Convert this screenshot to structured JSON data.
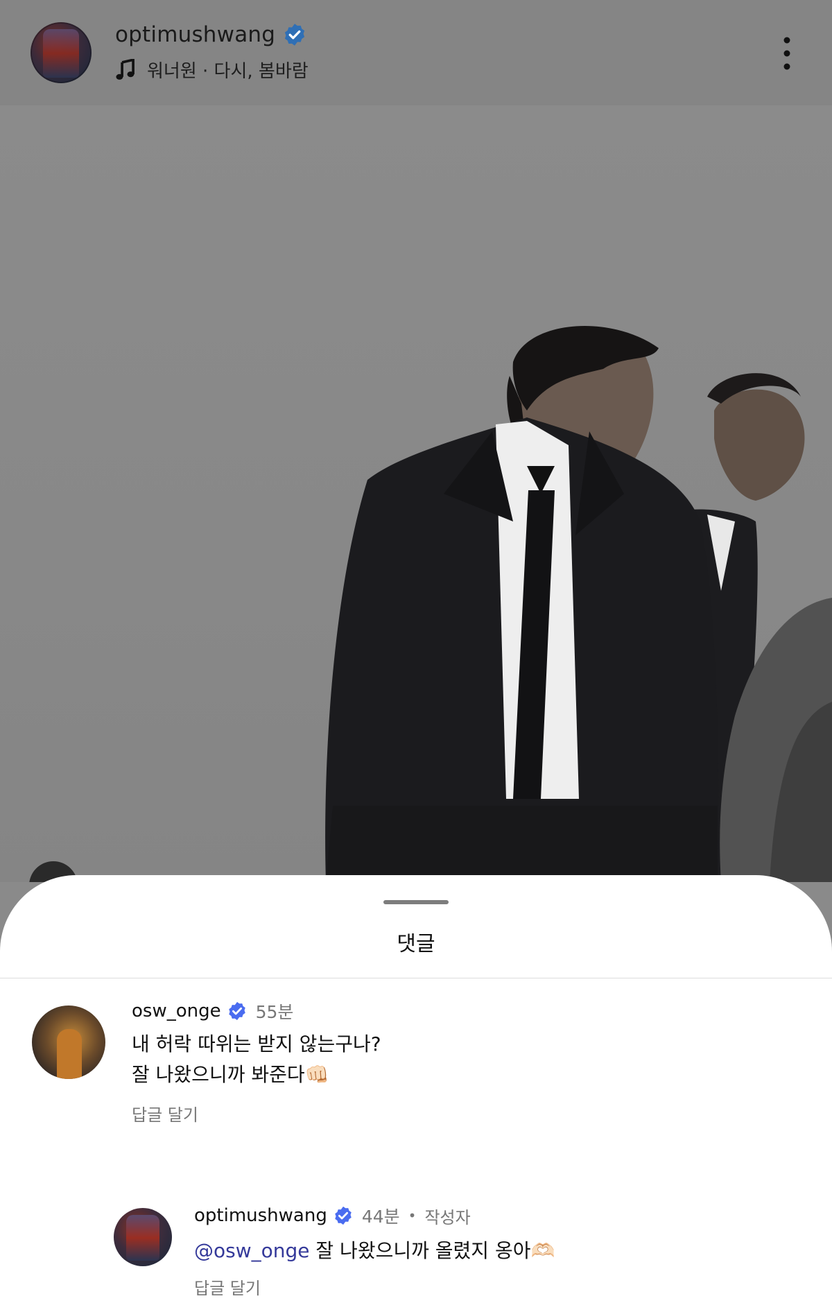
{
  "header": {
    "username": "optimushwang",
    "music": "워너원 · 다시, 봄바람",
    "icons": {
      "avatar": "profile-avatar",
      "verified": "verified-badge-icon",
      "music": "music-note-icon",
      "more": "more-vertical-icon"
    }
  },
  "comments_sheet": {
    "title": "댓글",
    "comments": [
      {
        "username": "osw_onge",
        "time": "55분",
        "lines": [
          "내 허락 따위는 받지 않는구나?",
          "잘 나왔으니까 봐준다👊🏻"
        ],
        "reply_label": "답글 달기"
      },
      {
        "username": "optimushwang",
        "time": "44분",
        "author_badge": "작성자",
        "mention": "@osw_onge",
        "text": " 잘 나왔으니까 올렸지 옹아🫶🏻",
        "reply_label": "답글 달기"
      }
    ]
  },
  "colors": {
    "verified": "#3b82f6",
    "mention": "#34399a",
    "muted": "#777777"
  }
}
